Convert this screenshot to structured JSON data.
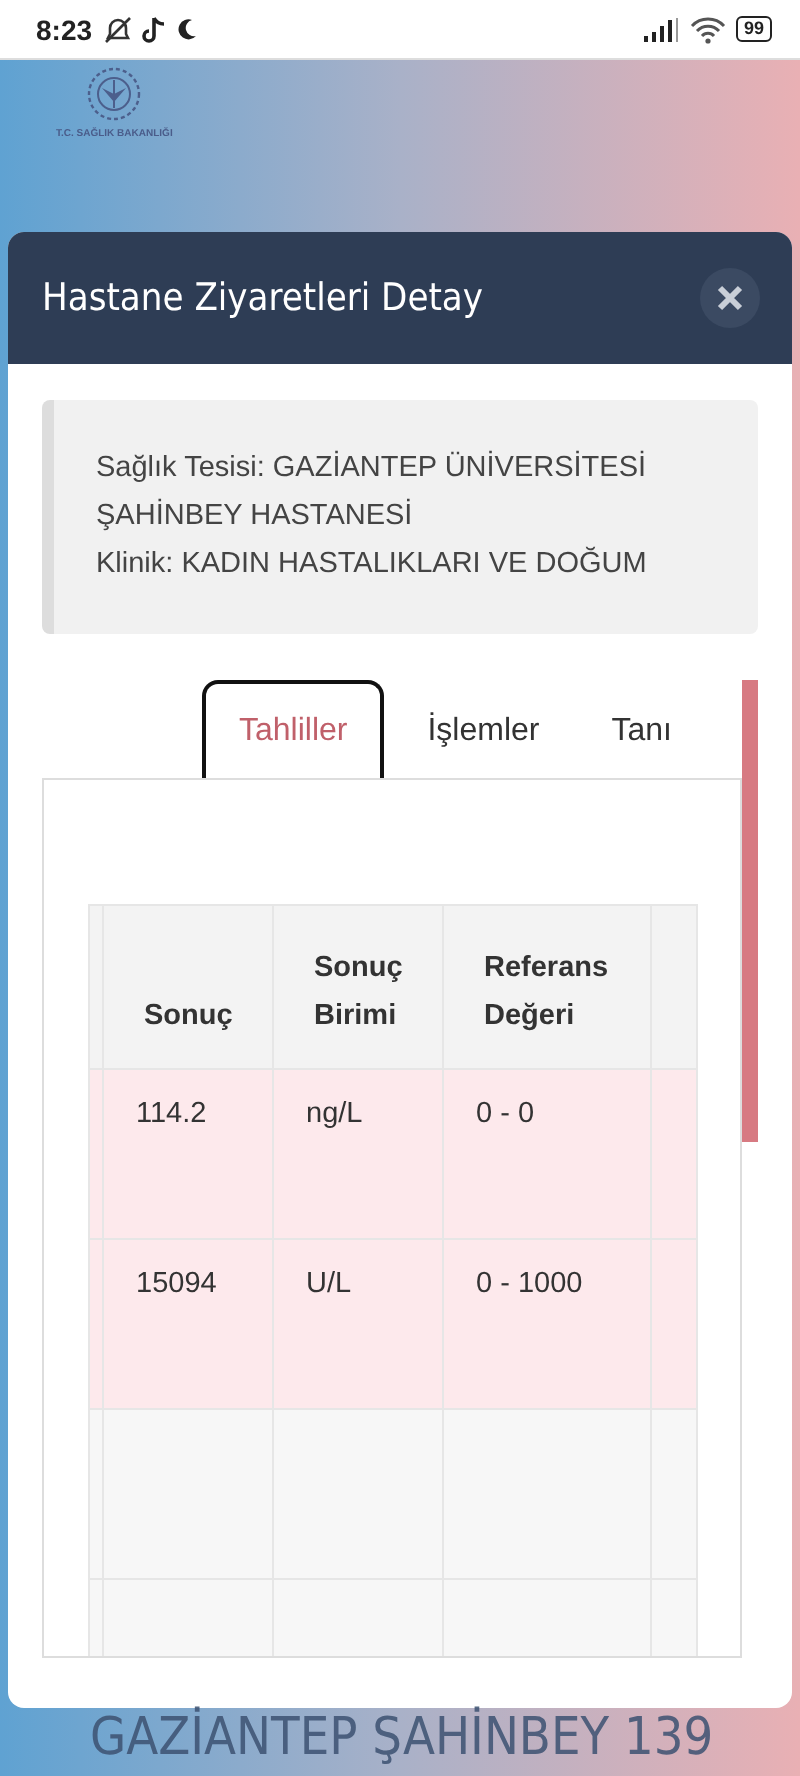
{
  "status_bar": {
    "time": "8:23",
    "battery": "99"
  },
  "logo": {
    "caption": "T.C. SAĞLIK BAKANLIĞI"
  },
  "modal": {
    "title": "Hastane Ziyaretleri Detay",
    "info": {
      "facility": "Sağlık Tesisi: GAZİANTEP ÜNİVERSİTESİ ŞAHİNBEY HASTANESİ",
      "clinic": "Klinik: KADIN HASTALIKLARI VE DOĞUM"
    },
    "tabs": [
      {
        "label": "Tahliller",
        "selected": true
      },
      {
        "label": "İşlemler",
        "selected": false
      },
      {
        "label": "Tanı",
        "selected": false
      }
    ],
    "table": {
      "columns": [
        "Sonuç",
        "Sonuç Birimi",
        "Referans Değeri"
      ],
      "rows": [
        {
          "kind": "result",
          "highlighted": true,
          "cells": [
            "114.2",
            "ng/L",
            "0 - 0"
          ]
        },
        {
          "kind": "result",
          "highlighted": true,
          "cells": [
            "15094",
            "U/L",
            "0 - 1000"
          ]
        },
        {
          "kind": "empty",
          "highlighted": false
        },
        {
          "kind": "empty",
          "highlighted": false
        }
      ]
    }
  },
  "background_text": [
    "GAZİANTEP ŞAHİNBEY 139"
  ]
}
